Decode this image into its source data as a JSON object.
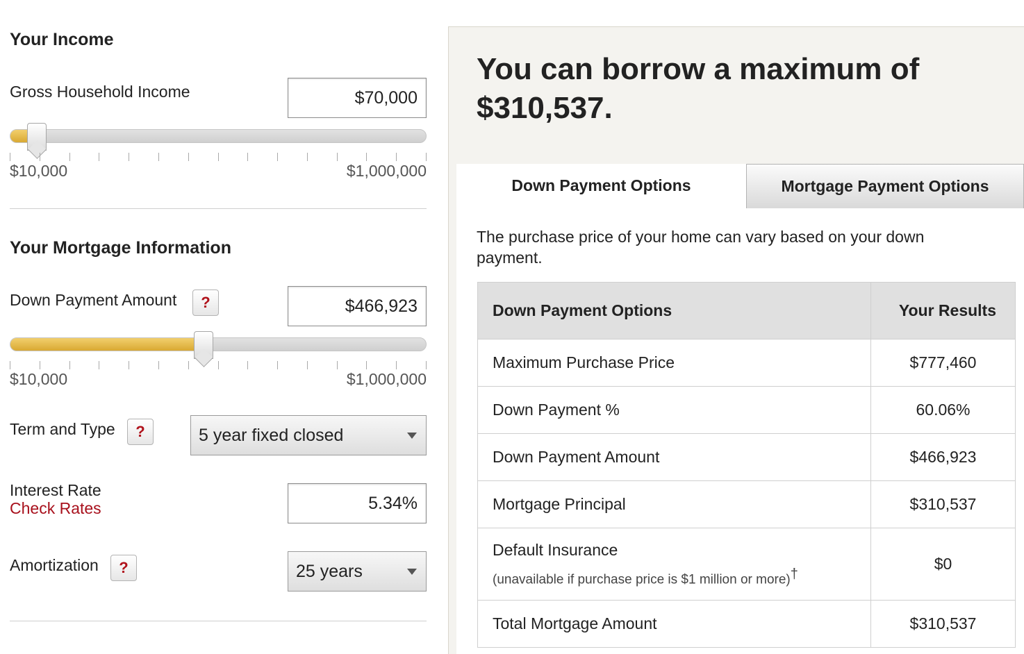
{
  "left": {
    "income_heading": "Your Income",
    "gross_income_label": "Gross Household Income",
    "gross_income_value": "$70,000",
    "income_slider": {
      "min_label": "$10,000",
      "max_label": "$1,000,000",
      "level": 0.06
    },
    "mortgage_heading": "Your Mortgage Information",
    "down_payment_label": "Down Payment Amount",
    "down_payment_value": "$466,923",
    "down_payment_slider": {
      "min_label": "$10,000",
      "max_label": "$1,000,000",
      "level": 0.46
    },
    "help_glyph": "?",
    "term_label": "Term and Type",
    "term_value": "5 year fixed closed",
    "interest_label": "Interest Rate",
    "check_rates_link": "Check Rates",
    "interest_value": "5.34%",
    "amortization_label": "Amortization",
    "amortization_value": "25 years"
  },
  "right": {
    "title": "You can borrow a maximum of $310,537.",
    "tabs": [
      {
        "label": "Down Payment Options",
        "active": true
      },
      {
        "label": "Mortgage Payment Options",
        "active": false
      }
    ],
    "description": "The purchase price of your home can vary based on your down payment.",
    "table": {
      "headers": [
        "Down Payment Options",
        "Your Results"
      ],
      "rows": [
        {
          "label": "Maximum Purchase Price",
          "value": "$777,460"
        },
        {
          "label": "Down Payment %",
          "value": "60.06%"
        },
        {
          "label": "Down Payment Amount",
          "value": "$466,923"
        },
        {
          "label": "Mortgage Principal",
          "value": "$310,537"
        },
        {
          "label": "Default Insurance",
          "note": "(unavailable if purchase price is $1 million or more)",
          "note_mark": "†",
          "value": "$0"
        },
        {
          "label": "Total Mortgage Amount",
          "value": "$310,537"
        }
      ]
    }
  },
  "colors": {
    "accent_gold": "#d9a932",
    "link_red": "#a8101c",
    "panel_bg": "#f4f3ef"
  }
}
